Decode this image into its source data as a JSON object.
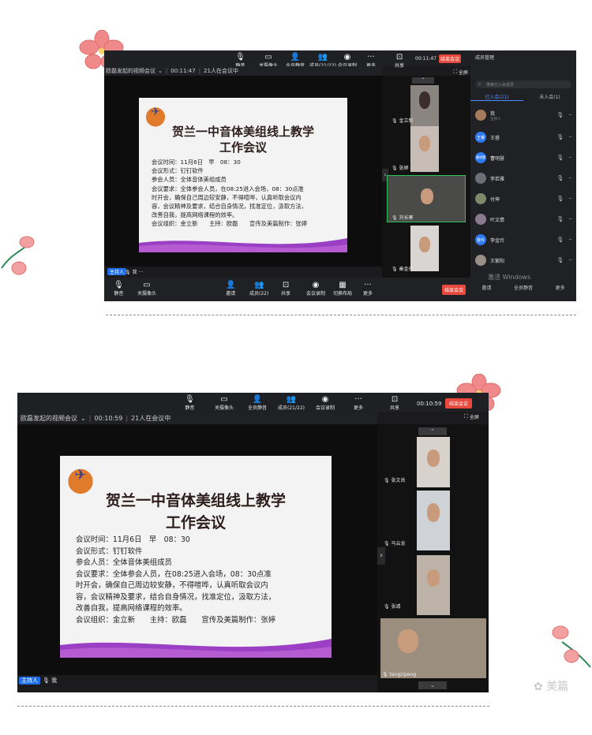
{
  "shot1": {
    "title": "欧磊发起的视频会议",
    "timer": "00:11:47",
    "participants_count": "21人在会议中",
    "toolbar": [
      {
        "icon": "mic-icon",
        "label": "静音"
      },
      {
        "icon": "camera-icon",
        "label": "关摄像头"
      },
      {
        "icon": "mute-all-icon",
        "label": "全员静音"
      },
      {
        "icon": "members-icon",
        "label": "成员(21/22)"
      },
      {
        "icon": "record-icon",
        "label": "会议录制"
      },
      {
        "icon": "more-icon",
        "label": "更多"
      },
      {
        "icon": "share-icon",
        "label": "共享"
      }
    ],
    "top_timer": "00:11:47",
    "end_button": "结束会议",
    "fullscreen": "全屏",
    "videos": [
      "金立新",
      "张婷",
      "刘长寒",
      "秦金丹"
    ],
    "host_tag": "主持人",
    "me_label": "我",
    "bottom_toolbar": [
      {
        "icon": "mic-icon",
        "label": "静音"
      },
      {
        "icon": "camera-icon",
        "label": "关摄像头"
      },
      {
        "icon": "invite-icon",
        "label": "邀请"
      },
      {
        "icon": "members-icon",
        "label": "成员(22)"
      },
      {
        "icon": "share-icon",
        "label": "共享"
      },
      {
        "icon": "record-icon",
        "label": "会议录制"
      },
      {
        "icon": "layout-icon",
        "label": "切换布局"
      },
      {
        "icon": "more-icon",
        "label": "更多"
      }
    ],
    "end_button_bottom": "结束会议",
    "panel": {
      "title": "成员管理",
      "search_placeholder": "搜索已入会成员",
      "tabs": [
        "已入会(21)",
        "未入会(1)"
      ],
      "members": [
        {
          "avatar": "",
          "name": "我",
          "sub": "主持人"
        },
        {
          "avatar": "王睿",
          "name": "王睿"
        },
        {
          "avatar": "曹明慧",
          "name": "曹明慧"
        },
        {
          "avatar": "",
          "name": "李若雅"
        },
        {
          "avatar": "",
          "name": "付坤"
        },
        {
          "avatar": "",
          "name": "叶文倩"
        },
        {
          "avatar": "金玲",
          "name": "李金玲"
        },
        {
          "avatar": "",
          "name": "王紫阳"
        }
      ],
      "watermark": "激活 Windows",
      "footer": [
        "邀请",
        "全员静音",
        "更多"
      ]
    }
  },
  "slide": {
    "title_line1": "贺兰一中音体美组线上教学",
    "title_line2": "工作会议",
    "lines": [
      "会议时间：11月6日　早　08：30",
      "会议形式：钉钉软件",
      "参会人员：全体音体美组成员",
      "会议要求：全体参会人员，在08:25进入会场，08：30点准",
      "时开会，确保自己周边较安静，不得喧哗，认真听取会议内",
      "容，会议精神及要求，结合自身情况，找准定位，汲取方法，",
      "改善自我，提高网络课程的效率。",
      "会议组织：金立新　　主持：欧磊　　宣传及美篇制作：张婷"
    ]
  },
  "shot2": {
    "title": "欧磊发起的视频会议",
    "timer": "00:10:59",
    "participants_count": "21人在会议中",
    "toolbar": [
      {
        "icon": "mic-icon",
        "label": "静音"
      },
      {
        "icon": "camera-icon",
        "label": "关摄像头"
      },
      {
        "icon": "mute-all-icon",
        "label": "全员静音"
      },
      {
        "icon": "members-icon",
        "label": "成员(21/22)"
      },
      {
        "icon": "record-icon",
        "label": "会议录制"
      },
      {
        "icon": "more-icon",
        "label": "更多"
      },
      {
        "icon": "share-icon",
        "label": "共享"
      }
    ],
    "top_timer": "00:10:59",
    "end_button": "结束会议",
    "fullscreen": "全屏",
    "videos": [
      "张文岳",
      "马云龙",
      "张靖",
      "tangzipeng"
    ],
    "host_tag": "主持人",
    "me_label": "我"
  },
  "brand": "美篇",
  "colors": {
    "accent": "#1f6feb",
    "danger": "#e8493c",
    "flower": "#f08a8a",
    "purple_wave": "#9b3fc4"
  }
}
